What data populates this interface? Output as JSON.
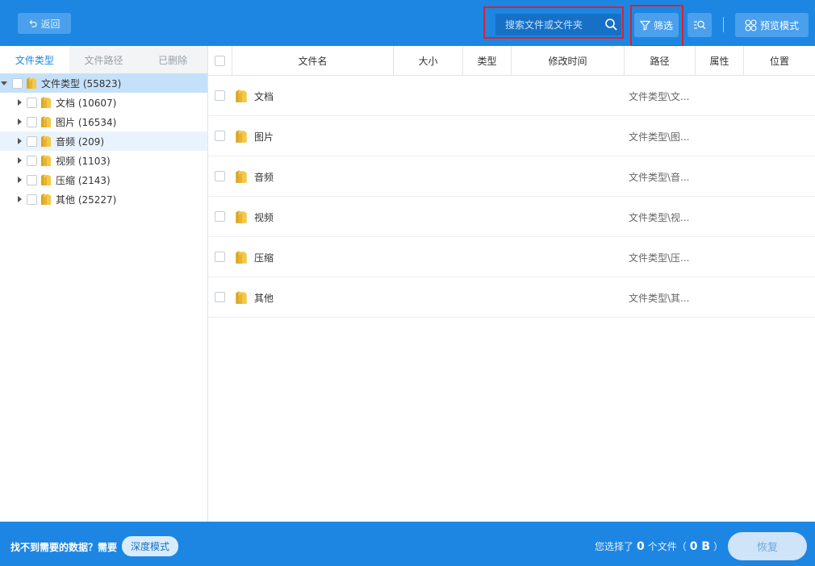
{
  "toolbar": {
    "back_label": "返回",
    "search_placeholder": "搜索文件或文件夹",
    "filter_label": "筛选",
    "preview_label": "预览模式"
  },
  "left_tabs": [
    {
      "label": "文件类型",
      "active": true
    },
    {
      "label": "文件路径",
      "active": false
    },
    {
      "label": "已删除",
      "active": false
    }
  ],
  "tree": {
    "root": {
      "label": "文件类型 (55823)"
    },
    "children": [
      {
        "label": "文档 (10607)"
      },
      {
        "label": "图片 (16534)"
      },
      {
        "label": "音频 (209)"
      },
      {
        "label": "视频 (1103)"
      },
      {
        "label": "压缩 (2143)"
      },
      {
        "label": "其他 (25227)"
      }
    ]
  },
  "table": {
    "columns": [
      "文件名",
      "大小",
      "类型",
      "修改时间",
      "路径",
      "属性",
      "位置"
    ],
    "rows": [
      {
        "name": "文档",
        "path": "文件类型\\文..."
      },
      {
        "name": "图片",
        "path": "文件类型\\图..."
      },
      {
        "name": "音频",
        "path": "文件类型\\音..."
      },
      {
        "name": "视频",
        "path": "文件类型\\视..."
      },
      {
        "name": "压缩",
        "path": "文件类型\\压..."
      },
      {
        "name": "其他",
        "path": "文件类型\\其..."
      }
    ]
  },
  "footer": {
    "hint": "找不到需要的数据？需要",
    "deep_mode_label": "深度模式",
    "status_prefix": "您选择了",
    "selected_count": "0",
    "status_mid": "个文件（",
    "selected_size": "0 B",
    "status_suffix": "）",
    "recover_label": "恢复"
  },
  "colors": {
    "primary": "#1d86e3",
    "highlight_box": "#e0202a",
    "selected_row": "#c5e1fa"
  }
}
